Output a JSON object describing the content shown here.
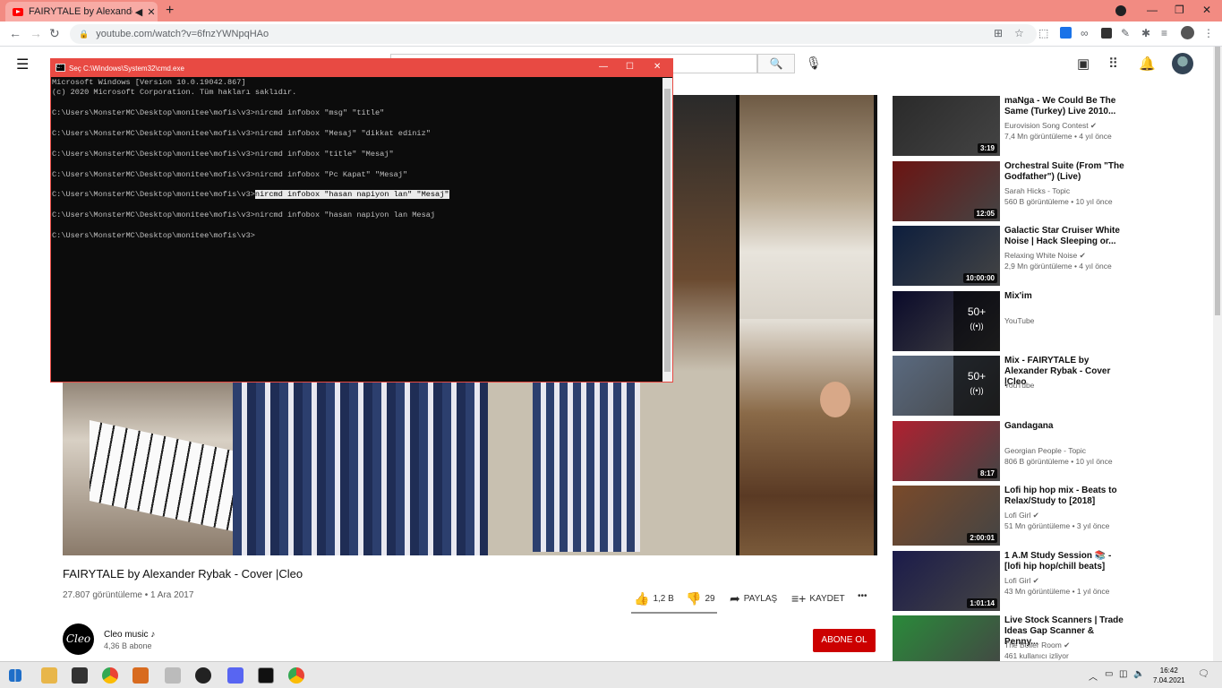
{
  "browser": {
    "tab_title": "FAIRYTALE by Alexander Rybak",
    "url": "youtube.com/watch?v=6fnzYWNpqHAo"
  },
  "cmd": {
    "title": "Seç C:\\Windows\\System32\\cmd.exe",
    "lines": [
      "Microsoft Windows [Version 10.0.19042.867]",
      "(c) 2020 Microsoft Corporation. Tüm hakları saklıdır.",
      "",
      "C:\\Users\\MonsterMC\\Desktop\\monitee\\mofis\\v3>nircmd infobox \"msg\" \"title\"",
      "",
      "C:\\Users\\MonsterMC\\Desktop\\monitee\\mofis\\v3>nircmd infobox \"Mesaj\" \"dikkat ediniz\"",
      "",
      "C:\\Users\\MonsterMC\\Desktop\\monitee\\mofis\\v3>nircmd infobox \"title\" \"Mesaj\"",
      "",
      "C:\\Users\\MonsterMC\\Desktop\\monitee\\mofis\\v3>nircmd infobox \"Pc Kapat\" \"Mesaj\"",
      "",
      "C:\\Users\\MonsterMC\\Desktop\\monitee\\mofis\\v3>"
    ],
    "selected_prompt": "C:\\Users\\MonsterMC\\Desktop\\monitee\\mofis\\v3>",
    "selected_text": "nircmd infobox \"hasan napiyon lan\" \"Mesaj\"",
    "line_after_selected": "",
    "line_last_cmd": "C:\\Users\\MonsterMC\\Desktop\\monitee\\mofis\\v3>nircmd infobox \"hasan napiyon lan Mesaj",
    "line_blank": "",
    "line_prompt": "C:\\Users\\MonsterMC\\Desktop\\monitee\\mofis\\v3>"
  },
  "video": {
    "title": "FAIRYTALE by Alexander Rybak - Cover |Cleo",
    "stats": "27.807 görüntüleme • 1 Ara 2017",
    "likes": "1,2 B",
    "dislikes": "29",
    "share": "PAYLAŞ",
    "save": "KAYDET",
    "more": "•••"
  },
  "channel": {
    "avatar_text": "Cleo",
    "name": "Cleo music ♪",
    "subs": "4,36 B abone",
    "subscribe": "ABONE OL"
  },
  "recommendations": [
    {
      "title": "maNga - We Could Be The Same (Turkey) Live 2010...",
      "channel": "Eurovision Song Contest ✔",
      "meta": "7,4 Mn görüntüleme • 4 yıl önce",
      "duration": "3:19",
      "thumb_color": "#2a2a2a"
    },
    {
      "title": "Orchestral Suite (From \"The Godfather\") (Live)",
      "channel": "Sarah Hicks - Topic",
      "meta": "560 B görüntüleme • 10 yıl önce",
      "duration": "12:05",
      "thumb_color": "#6b1412"
    },
    {
      "title": "Galactic Star Cruiser White Noise | Hack Sleeping or...",
      "channel": "Relaxing White Noise ✔",
      "meta": "2,9 Mn görüntüleme • 4 yıl önce",
      "duration": "10:00:00",
      "thumb_color": "#0d1e3d"
    },
    {
      "title": "Mix'im",
      "channel": "YouTube",
      "meta": "",
      "duration": "",
      "mix": "50+",
      "thumb_color": "#0a0a2a"
    },
    {
      "title": "Mix - FAIRYTALE by Alexander Rybak - Cover |Cleo",
      "channel": "YouTube",
      "meta": "",
      "duration": "",
      "mix": "50+",
      "thumb_color": "#5a6a80"
    },
    {
      "title": "Gandagana",
      "channel": "Georgian People - Topic",
      "meta": "806 B görüntüleme • 10 yıl önce",
      "duration": "8:17",
      "thumb_color": "#b02030"
    },
    {
      "title": "Lofi hip hop mix - Beats to Relax/Study to [2018]",
      "channel": "Lofi Girl ✔",
      "meta": "51 Mn görüntüleme • 3 yıl önce",
      "duration": "2:00:01",
      "thumb_color": "#7a4a2a"
    },
    {
      "title": "1 A.M Study Session 📚 - [lofi hip hop/chill beats]",
      "channel": "Lofi Girl ✔",
      "meta": "43 Mn görüntüleme • 1 yıl önce",
      "duration": "1:01:14",
      "thumb_color": "#1b1b4a"
    },
    {
      "title": "Live Stock Scanners | Trade Ideas Gap Scanner & Penny...",
      "channel": "The Boiler Room ✔",
      "meta": "461 kullanıcı izliyor",
      "duration": "",
      "thumb_color": "#2a8a3a"
    }
  ],
  "taskbar": {
    "time": "16:42",
    "date": "7.04.2021"
  }
}
